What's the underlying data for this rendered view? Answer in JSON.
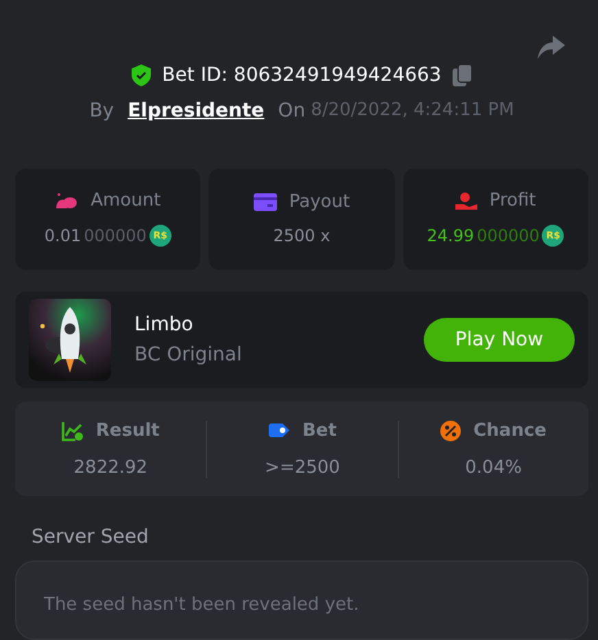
{
  "bet": {
    "id_label": "Bet ID: 80632491949424663",
    "by_label": "By",
    "user": "Elpresidente",
    "on_label": "On",
    "date": "8/20/2022, 4:24:11 PM"
  },
  "stats": [
    {
      "kind": "amount",
      "label": "Amount",
      "value": "0.01",
      "trail": "000000",
      "currency": "R$"
    },
    {
      "kind": "payout",
      "label": "Payout",
      "value": "2500 x"
    },
    {
      "kind": "profit",
      "label": "Profit",
      "value": "24.99",
      "trail": "000000",
      "currency": "R$"
    }
  ],
  "game": {
    "name": "Limbo",
    "provider": "BC Original",
    "button": "Play Now"
  },
  "details": [
    {
      "kind": "result",
      "label": "Result",
      "value": "2822.92"
    },
    {
      "kind": "bet",
      "label": "Bet",
      "value": ">=2500"
    },
    {
      "kind": "chance",
      "label": "Chance",
      "value": "0.04%"
    }
  ],
  "server_seed": {
    "label": "Server Seed",
    "text": "The seed hasn't been revealed yet."
  }
}
